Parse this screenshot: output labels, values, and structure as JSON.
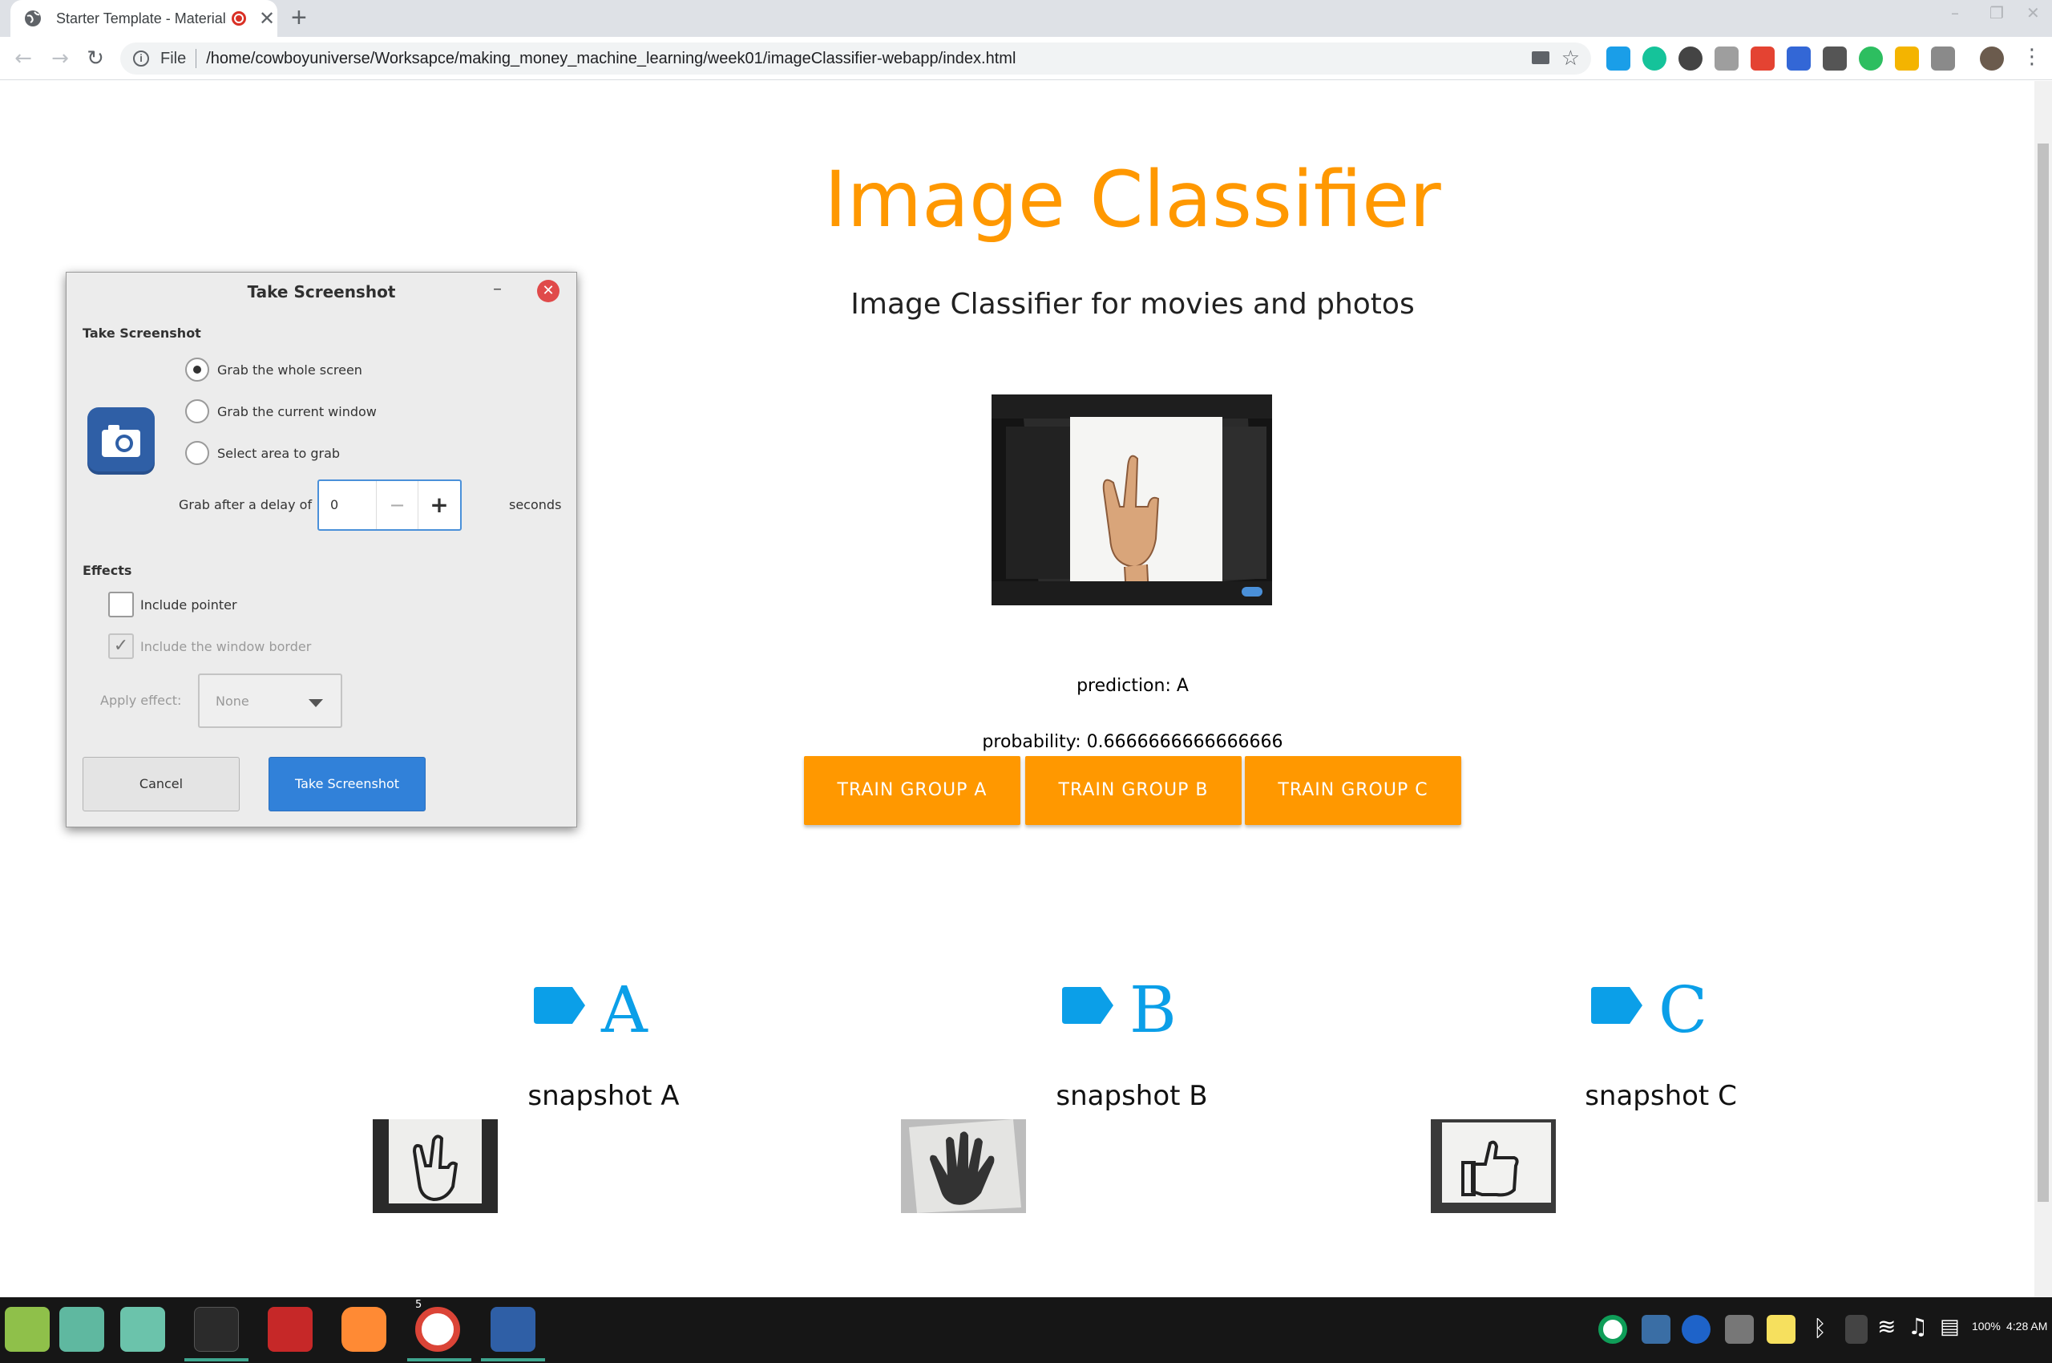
{
  "browser": {
    "tab_title": "Starter Template - Materialize",
    "new_tab": "+",
    "address_scheme": "File",
    "address_url": "/home/cowboyuniverse/Worksapce/making_money_machine_learning/week01/imageClassifier-webapp/index.html"
  },
  "page": {
    "title": "Image Classifier",
    "subtitle": "Image Classifier for movies and photos",
    "prediction": "prediction: A",
    "probability": "probability: 0.6666666666666666",
    "buttons": [
      "TRAIN GROUP A",
      "TRAIN GROUP B",
      "TRAIN GROUP C"
    ],
    "groups": [
      {
        "letter": "A",
        "label": "snapshot A"
      },
      {
        "letter": "B",
        "label": "snapshot B"
      },
      {
        "letter": "C",
        "label": "snapshot C"
      }
    ],
    "accent_color": "#ff9800",
    "label_color": "#0b9fe8"
  },
  "dialog": {
    "title": "Take Screenshot",
    "section_take": "Take Screenshot",
    "options": [
      "Grab the whole screen",
      "Grab the current window",
      "Select area to grab"
    ],
    "selected_option": "Grab the whole screen",
    "delay_label": "Grab after a delay of",
    "delay_value": "0",
    "seconds_label": "seconds",
    "section_effects": "Effects",
    "include_pointer": "Include pointer",
    "include_border": "Include the window border",
    "apply_effect_label": "Apply effect:",
    "apply_effect_value": "None",
    "cancel": "Cancel",
    "take": "Take Screenshot"
  },
  "taskbar": {
    "chrome_badge": "5",
    "battery": "100%",
    "clock": "4:28 AM"
  }
}
